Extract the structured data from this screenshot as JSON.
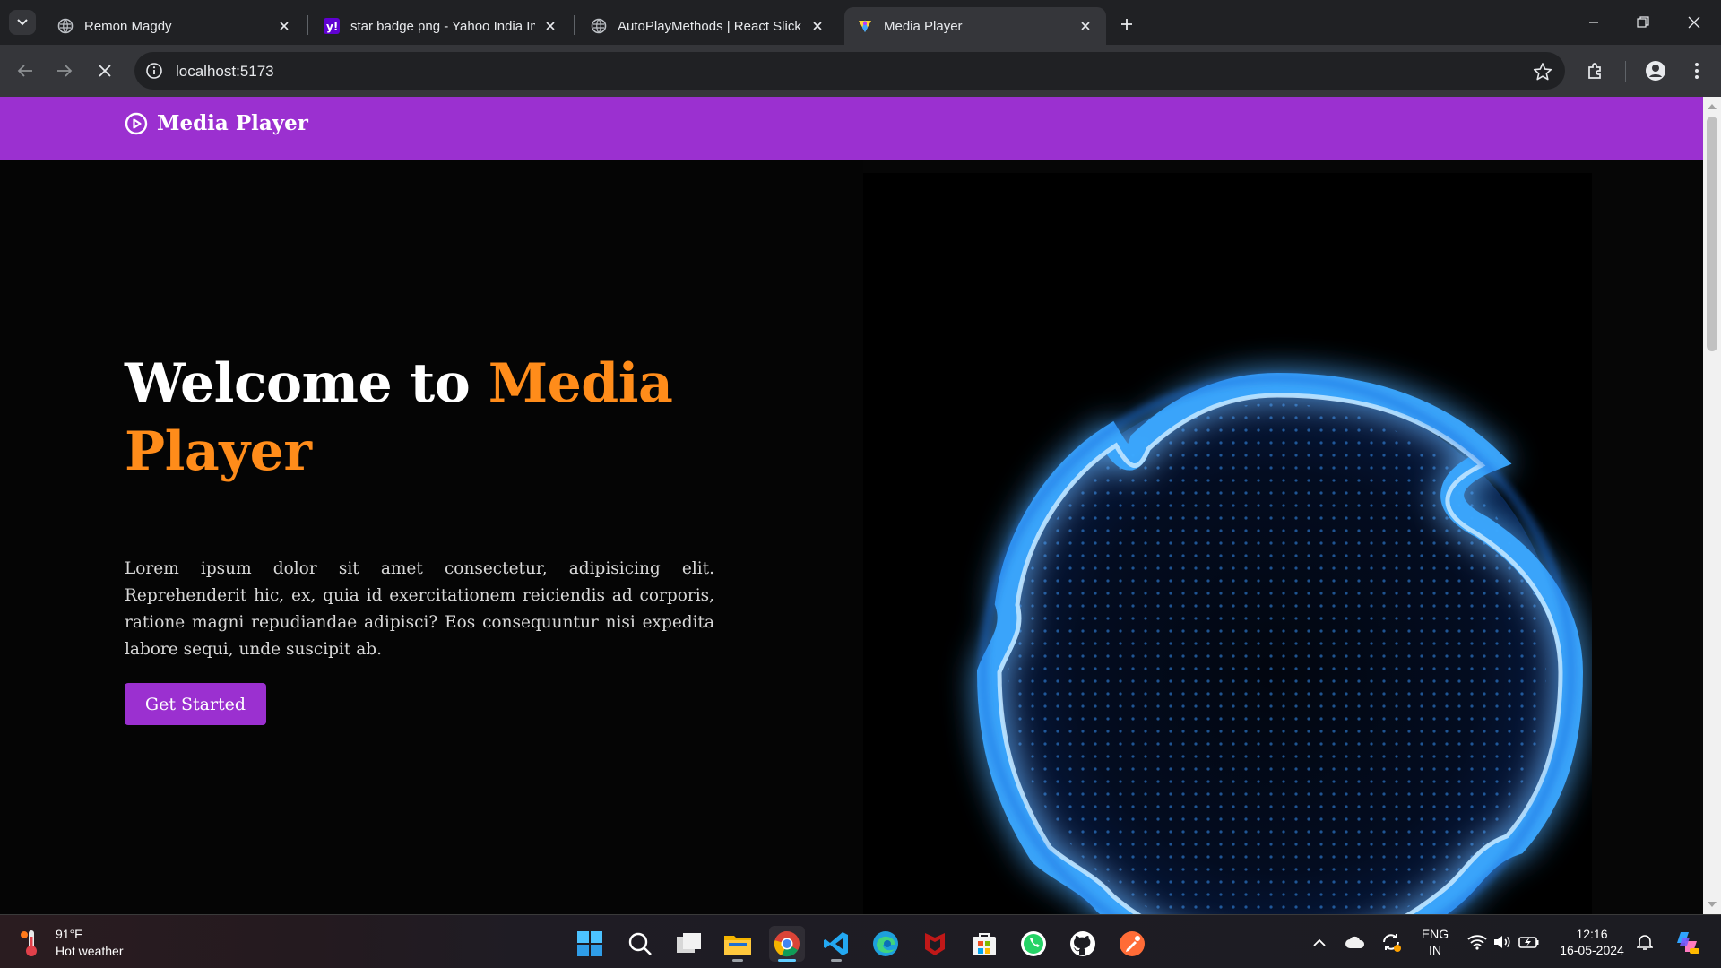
{
  "browser": {
    "tabs": [
      {
        "title": "Remon Magdy",
        "favicon": "globe-icon",
        "active": false
      },
      {
        "title": "star badge png - Yahoo India Im",
        "favicon": "yahoo-icon",
        "active": false
      },
      {
        "title": "AutoPlayMethods | React Slick",
        "favicon": "globe-icon",
        "active": false
      },
      {
        "title": "Media Player",
        "favicon": "react-icon",
        "active": true
      }
    ],
    "address": "localhost:5173"
  },
  "site": {
    "brand": "Media Player",
    "hero": {
      "title_plain": "Welcome to ",
      "title_accent": "Media Player",
      "description": "Lorem ipsum dolor sit amet consectetur, adipisicing elit. Reprehenderit hic, ex, quia id exercitationem reiciendis ad corporis, ratione magni repudiandae adipisci? Eos consequuntur nisi expedita labore sequi, unde suscipit ab.",
      "cta_label": "Get Started"
    },
    "colors": {
      "brand_purple": "#9b30d0",
      "accent_orange": "#ff8c1a",
      "orb_blue": "#3aa8ff"
    }
  },
  "taskbar": {
    "weather": {
      "temp": "91°F",
      "desc": "Hot weather"
    },
    "apps": [
      "start-icon",
      "search-icon",
      "task-view-icon",
      "file-explorer-icon",
      "chrome-icon",
      "vscode-icon",
      "edge-icon",
      "mcafee-icon",
      "store-icon",
      "whatsapp-icon",
      "github-icon",
      "postman-icon"
    ],
    "language": {
      "line1": "ENG",
      "line2": "IN"
    },
    "clock": {
      "time": "12:16",
      "date": "16-05-2024"
    }
  }
}
